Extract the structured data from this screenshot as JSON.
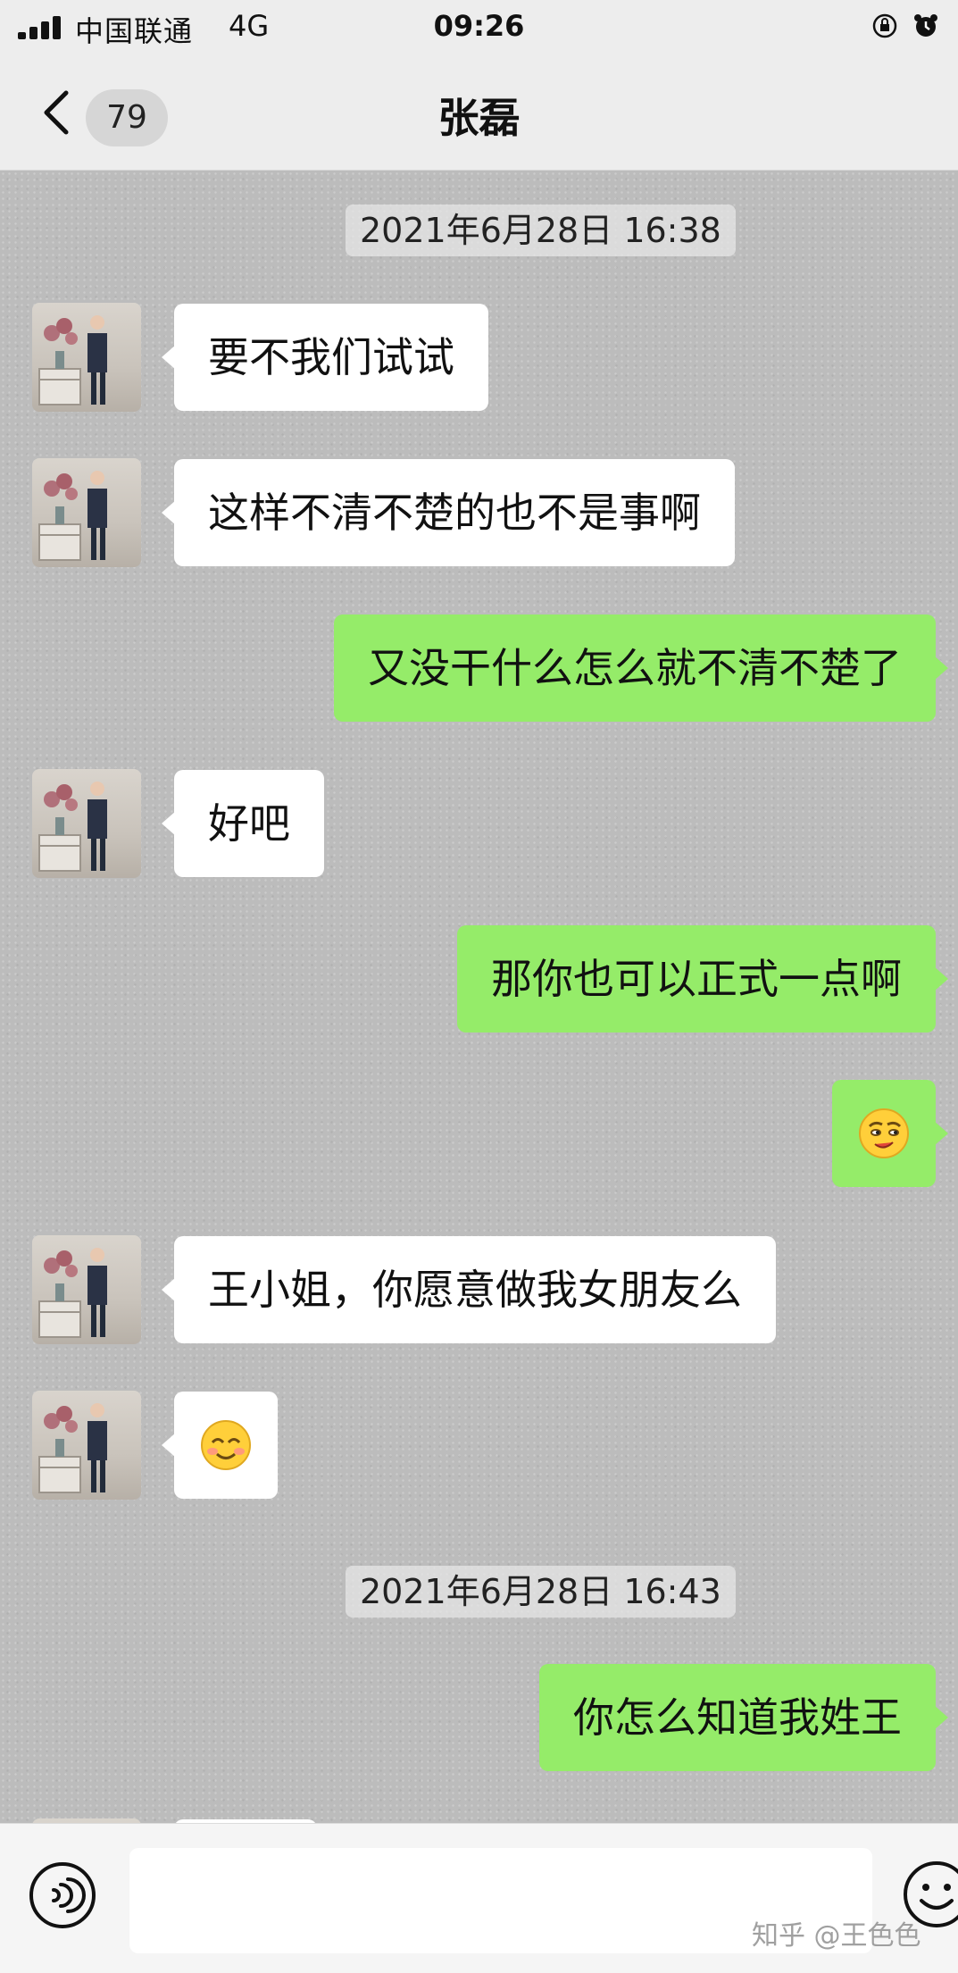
{
  "status_bar": {
    "carrier": "中国联通",
    "network": "4G",
    "time": "09:26"
  },
  "nav": {
    "unread_count": "79",
    "title": "张磊"
  },
  "timestamps": [
    "2021年6月28日 16:38",
    "2021年6月28日 16:43"
  ],
  "messages": [
    {
      "side": "in",
      "text": "要不我们试试"
    },
    {
      "side": "in",
      "text": "这样不清不楚的也不是事啊"
    },
    {
      "side": "out",
      "text": "又没干什么怎么就不清不楚了"
    },
    {
      "side": "in",
      "text": "好吧"
    },
    {
      "side": "out",
      "text": "那你也可以正式一点啊"
    },
    {
      "side": "out",
      "emoji": "smirk-face-emoji"
    },
    {
      "side": "in",
      "text": "王小姐，你愿意做我女朋友么"
    },
    {
      "side": "in",
      "emoji": "smiling-face-emoji"
    },
    {
      "side": "out",
      "text": "你怎么知道我姓王"
    }
  ],
  "watermark": "知乎 @王色色",
  "colors": {
    "outgoing_bubble": "#95ec69",
    "incoming_bubble": "#ffffff",
    "chat_background": "#bcbcbc"
  },
  "icons": {
    "back": "chevron-left-icon",
    "voice": "voice-icon",
    "emoji": "smiley-icon"
  }
}
